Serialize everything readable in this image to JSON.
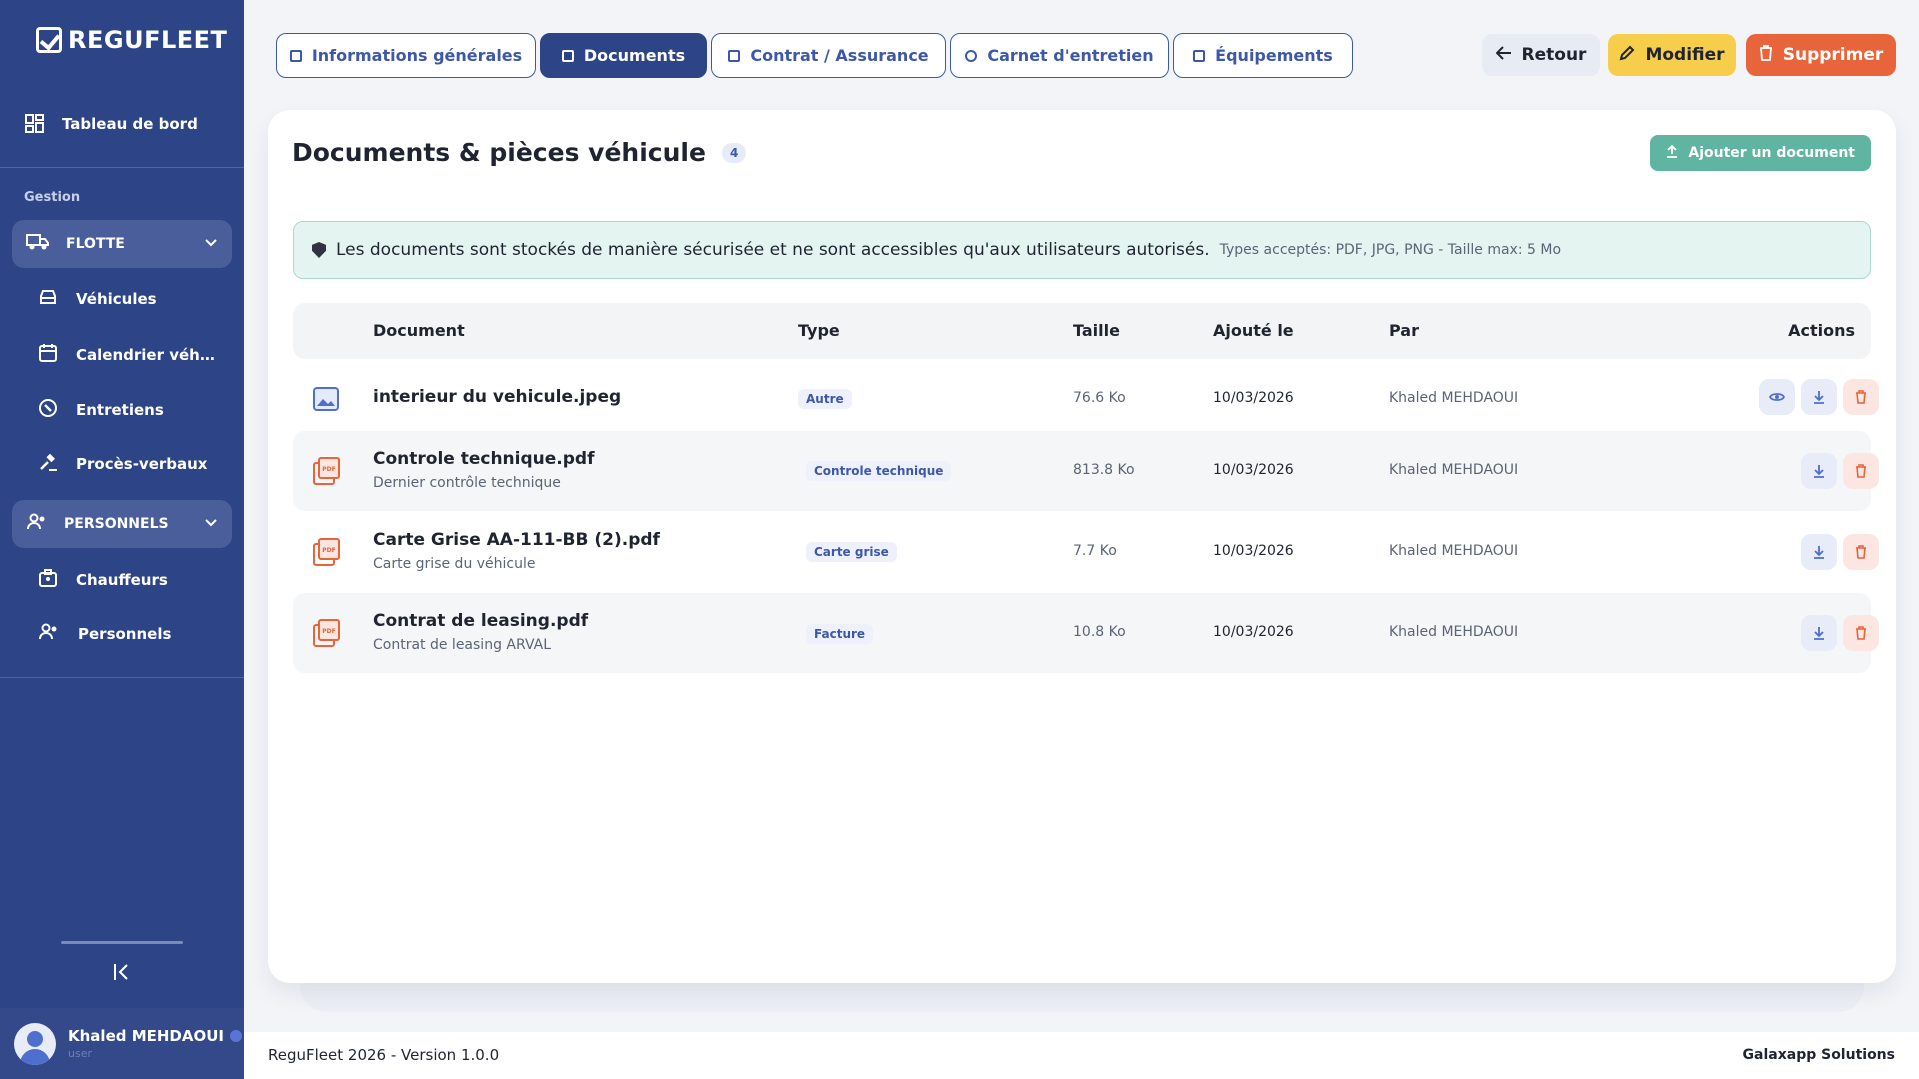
{
  "brand": {
    "name": "REGUFLEET"
  },
  "sidebar": {
    "dashboard": "Tableau de bord",
    "section_label": "Gestion",
    "groups": [
      {
        "label": "FLOTTE",
        "items": [
          "Véhicules",
          "Calendrier véhicu...",
          "Entretiens",
          "Procès-verbaux"
        ]
      },
      {
        "label": "PERSONNELS",
        "items": [
          "Chauffeurs",
          "Personnels"
        ]
      }
    ],
    "user": {
      "name": "Khaled MEHDAOUI",
      "role": "user"
    }
  },
  "tabs": [
    {
      "label": "Informations générales",
      "active": false
    },
    {
      "label": "Documents",
      "active": true
    },
    {
      "label": "Contrat / Assurance",
      "active": false
    },
    {
      "label": "Carnet d'entretien",
      "active": false
    },
    {
      "label": "Équipements",
      "active": false
    }
  ],
  "actions": {
    "back": "Retour",
    "edit": "Modifier",
    "delete": "Supprimer"
  },
  "colors": {
    "primary": "#2d4486",
    "edit": "#f7ce4c",
    "danger": "#e8643b",
    "success": "#5fb5a1"
  },
  "documents": {
    "title": "Documents & pièces véhicule",
    "count": "4",
    "add_button": "Ajouter un document",
    "notice": "Les documents sont stockés de manière sécurisée et ne sont accessibles qu'aux utilisateurs autorisés.",
    "notice_small": "Types acceptés: PDF, JPG, PNG - Taille max: 5 Mo",
    "columns": [
      "Document",
      "Type",
      "Taille",
      "Ajouté le",
      "Par",
      "Actions"
    ],
    "rows": [
      {
        "icon": "image-file-icon",
        "name": "interieur du vehicule.jpeg",
        "desc": "",
        "type": "Autre",
        "size": "76.6 Ko",
        "date": "10/03/2026",
        "by": "Khaled MEHDAOUI",
        "actions": [
          "view",
          "download",
          "delete"
        ]
      },
      {
        "icon": "pdf-file-icon",
        "name": "Controle technique.pdf",
        "desc": "Dernier contrôle technique",
        "type": "Controle technique",
        "size": "813.8 Ko",
        "date": "10/03/2026",
        "by": "Khaled MEHDAOUI",
        "actions": [
          "download",
          "delete"
        ]
      },
      {
        "icon": "pdf-file-icon",
        "name": "Carte Grise AA-111-BB (2).pdf",
        "desc": "Carte grise du véhicule",
        "type": "Carte grise",
        "size": "7.7 Ko",
        "date": "10/03/2026",
        "by": "Khaled MEHDAOUI",
        "actions": [
          "download",
          "delete"
        ]
      },
      {
        "icon": "pdf-file-icon",
        "name": "Contrat de leasing.pdf",
        "desc": "Contrat de leasing ARVAL",
        "type": "Facture",
        "size": "10.8 Ko",
        "date": "10/03/2026",
        "by": "Khaled MEHDAOUI",
        "actions": [
          "download",
          "delete"
        ]
      }
    ]
  },
  "footer": {
    "left": "ReguFleet 2026 - Version 1.0.0",
    "right": "Galaxapp Solutions"
  }
}
